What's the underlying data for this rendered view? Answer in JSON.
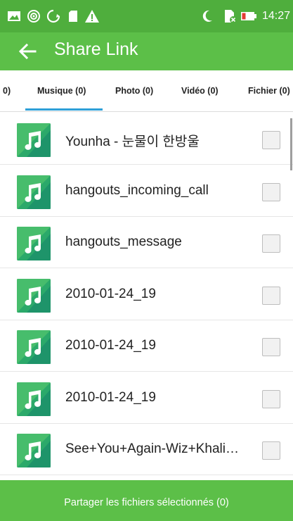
{
  "status_bar": {
    "time": "14:27",
    "icons": [
      "image-icon",
      "hotspot-icon",
      "sync-icon",
      "sd-card-icon",
      "warning-icon",
      "moon-icon",
      "sim-off-icon",
      "battery-low-icon"
    ]
  },
  "app_bar": {
    "title": "Share Link",
    "back_icon": "arrow-left-icon"
  },
  "tabs": [
    {
      "label": "0)",
      "selected": false
    },
    {
      "label": "Musique (0)",
      "selected": true
    },
    {
      "label": "Photo (0)",
      "selected": false
    },
    {
      "label": "Vidéo (0)",
      "selected": false
    },
    {
      "label": "Fichier (0)",
      "selected": false
    }
  ],
  "files": [
    {
      "name": "Younha - 눈물이 한방울",
      "checked": false,
      "icon": "music-note-icon"
    },
    {
      "name": "hangouts_incoming_call",
      "checked": false,
      "icon": "music-note-icon"
    },
    {
      "name": "hangouts_message",
      "checked": false,
      "icon": "music-note-icon"
    },
    {
      "name": "2010-01-24_19",
      "checked": false,
      "icon": "music-note-icon"
    },
    {
      "name": "2010-01-24_19",
      "checked": false,
      "icon": "music-note-icon"
    },
    {
      "name": "2010-01-24_19",
      "checked": false,
      "icon": "music-note-icon"
    },
    {
      "name": "See+You+Again-Wiz+Khali…",
      "checked": false,
      "icon": "music-note-icon"
    }
  ],
  "share_button": {
    "label": "Partager les fichiers sélectionnés (0)"
  },
  "colors": {
    "status_bar": "#4fae3d",
    "app_bar": "#5cbf48",
    "tab_indicator": "#2ea0d8",
    "music_icon": "#2ba96a"
  }
}
